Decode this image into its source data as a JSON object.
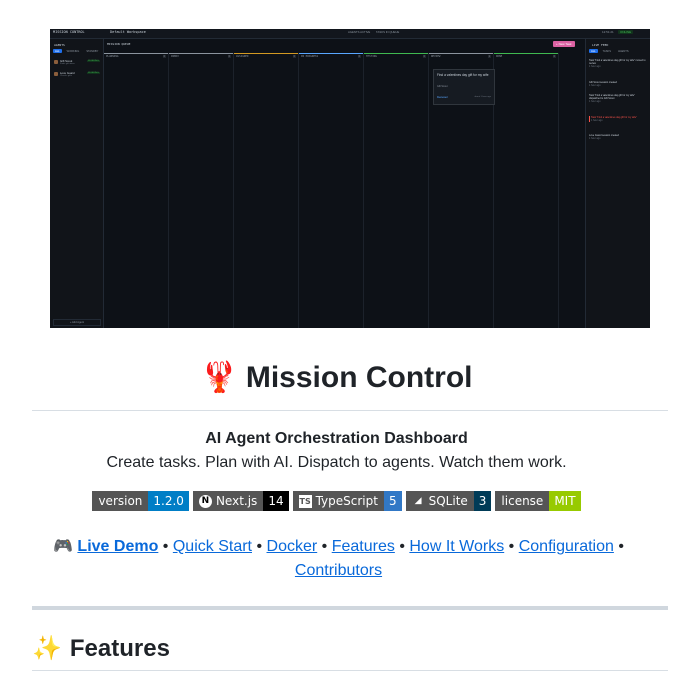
{
  "screenshot": {
    "brand": "MISSION CONTROL",
    "workspace": "Default Workspace",
    "stats": [
      "AGENTS ACTIVE",
      "TASKS IN QUEUE"
    ],
    "time": "12:51:21",
    "online": "ONLINE",
    "agents_title": "AGENTS",
    "agent_tabs": [
      "ALL",
      "WORKING",
      "STANDBY"
    ],
    "agents": [
      {
        "name": "Gift Scout",
        "role": "Finds gift ideas",
        "status": "WORKING"
      },
      {
        "name": "Love Guard",
        "role": "Checks gifts",
        "status": "WORKING"
      }
    ],
    "add_agent": "+ Add Agent",
    "board_title": "MISSION QUEUE",
    "new_task": "+ New Task",
    "columns": [
      {
        "label": "PLANNING",
        "count": "0"
      },
      {
        "label": "INBOX",
        "count": "0"
      },
      {
        "label": "ASSIGNED",
        "count": "0"
      },
      {
        "label": "IN PROGRESS",
        "count": "0"
      },
      {
        "label": "TESTING",
        "count": "0"
      },
      {
        "label": "REVIEW",
        "count": "1"
      },
      {
        "label": "DONE",
        "count": "0"
      }
    ],
    "card": {
      "title": "Find a valentines day gift for my wife",
      "agent": "Gift Scout",
      "status": "Reviewed",
      "time": "about 1 hour ago"
    },
    "live_title": "LIVE FEED",
    "live_tabs": [
      "ALL",
      "TASKS",
      "AGENTS"
    ],
    "live_items": [
      {
        "text": "Task \"Find a valentines day gift for my wife\" moved to review",
        "sub": "1 hour ago"
      },
      {
        "text": "Gift Scout session created",
        "sub": "1 hour ago"
      },
      {
        "text": "Task \"Find a valentines day gift for my wife\" dispatched to Gift Scout",
        "sub": "1 hour ago"
      },
      {
        "text": "Task \"Find a valentines day gift for my wife\"",
        "sub": "1 hour ago"
      },
      {
        "text": "Love Guard session created",
        "sub": "1 hour ago"
      }
    ]
  },
  "document": {
    "emoji": "🦞",
    "title": "Mission Control",
    "subtitle": "AI Agent Orchestration Dashboard",
    "tagline": "Create tasks. Plan with AI. Dispatch to agents. Watch them work.",
    "badges": [
      {
        "label": "version",
        "value": "1.2.0",
        "color": "#007ec6",
        "icon": ""
      },
      {
        "label": "Next.js",
        "value": "14",
        "color": "#000000",
        "icon": "N"
      },
      {
        "label": "TypeScript",
        "value": "5",
        "color": "#3178c6",
        "icon": "TS"
      },
      {
        "label": "SQLite",
        "value": "3",
        "color": "#003b57",
        "icon": "◢"
      },
      {
        "label": "license",
        "value": "MIT",
        "color": "#97ca00",
        "icon": ""
      }
    ],
    "links": {
      "demo_emoji": "🎮",
      "items": [
        "Live Demo",
        "Quick Start",
        "Docker",
        "Features",
        "How It Works",
        "Configuration",
        "Contributors"
      ],
      "separator": "•"
    },
    "features_emoji": "✨",
    "features_heading": "Features"
  }
}
